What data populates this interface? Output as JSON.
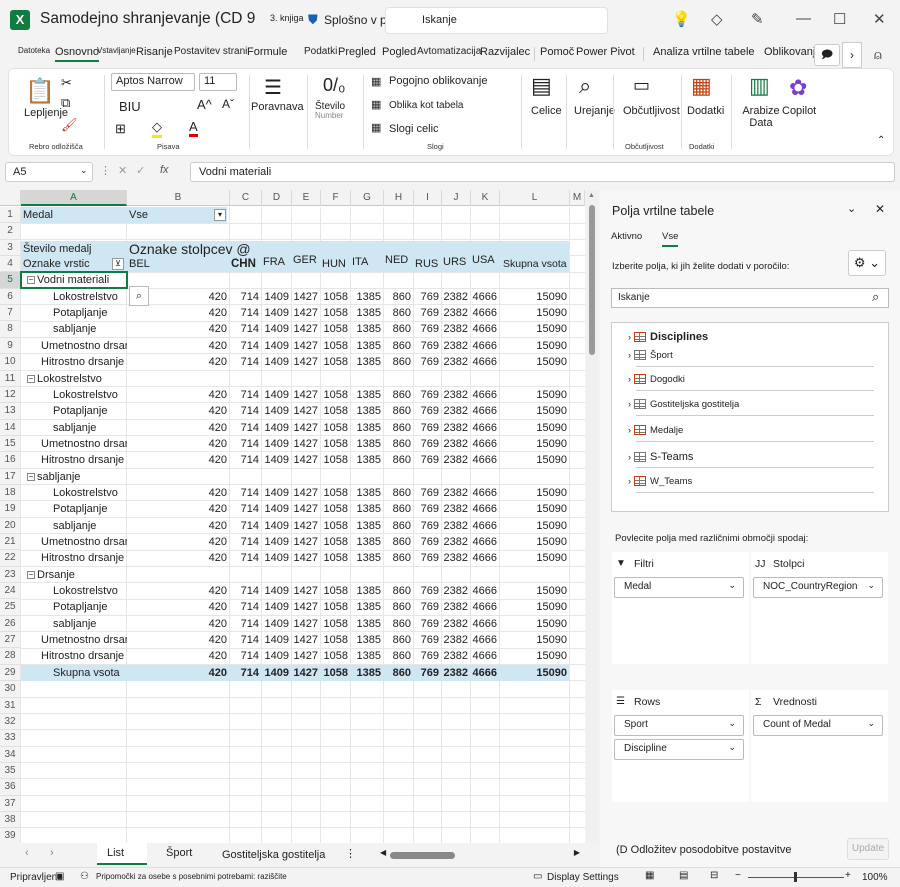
{
  "titlebar": {
    "title": "Samodejno shranjevanje (CD 9",
    "book": "3. knjiga",
    "sensitivity": "Splošno v p",
    "search": "Iskanje"
  },
  "tabs": [
    "Datoteka",
    "Osnovno",
    "Vstavljanje",
    "Risanje",
    "Postavitev strani",
    "Formule",
    "Podatki",
    "Pregled",
    "Pogled",
    "Avtomatizacija",
    "Razvijalec",
    "Pomoč",
    "Power Pivot",
    "Analiza vrtilne tabele",
    "Oblikovanje"
  ],
  "ribbon": {
    "paste": "Lepljenje",
    "clipboard_group": "Rebro odložišča",
    "font_name": "Aptos Narrow",
    "font_size": "11",
    "bold_italic_underline": "BIU",
    "font_group": "Pisava",
    "alignment": "Poravnava",
    "number": "Število",
    "number_sub": "Number",
    "conditional": "Pogojno oblikovanje",
    "format_table": "Oblika kot tabela",
    "cell_styles": "Slogi celic",
    "styles_group": "Slogi",
    "cells": "Celice",
    "editing": "Urejanje",
    "sensitivity": "Občutljivost",
    "sensitivity_group": "Občutljivost",
    "addins": "Dodatki",
    "addins_group": "Dodatki",
    "analyze": "Arabize Data",
    "copilot": "Copilot"
  },
  "formula": {
    "namebox": "A5",
    "fx": "fx",
    "content": "Vodni materiali"
  },
  "columns": [
    "A",
    "B",
    "C",
    "D",
    "E",
    "F",
    "G",
    "H",
    "I",
    "J",
    "K",
    "L",
    "M"
  ],
  "cells": {
    "a1": "Medal",
    "b1": "Vse",
    "a3": "Število medalj",
    "b3": "Oznake stolpcev @",
    "a4": "Oznake vrstic",
    "b4": "BEL",
    "countries": [
      "CHN",
      "FRA",
      "GER",
      "HUN",
      "ITA",
      "NED",
      "RUS",
      "URS",
      "USA"
    ],
    "total_header": "Skupna vsota"
  },
  "rows": [
    {
      "r": "1"
    },
    {
      "r": "2"
    },
    {
      "r": "3"
    },
    {
      "r": "4"
    },
    {
      "r": "5",
      "label": "Vodni materiali",
      "level": 0
    },
    {
      "r": "6",
      "label": "Lokostrelstvo",
      "level": 2,
      "vals": [
        "420",
        "714",
        "1409",
        "1427",
        "1058",
        "1385",
        "860",
        "769",
        "2382",
        "4666",
        "15090"
      ]
    },
    {
      "r": "7",
      "label": "Potapljanje",
      "level": 2,
      "vals": [
        "420",
        "714",
        "1409",
        "1427",
        "1058",
        "1385",
        "860",
        "769",
        "2382",
        "4666",
        "15090"
      ]
    },
    {
      "r": "8",
      "label": "sabljanje",
      "level": 2,
      "vals": [
        "420",
        "714",
        "1409",
        "1427",
        "1058",
        "1385",
        "860",
        "769",
        "2382",
        "4666",
        "15090"
      ]
    },
    {
      "r": "9",
      "label": "Umetnostno drsanje",
      "level": 1,
      "vals": [
        "420",
        "714",
        "1409",
        "1427",
        "1058",
        "1385",
        "860",
        "769",
        "2382",
        "4666",
        "15090"
      ]
    },
    {
      "r": "10",
      "label": "Hitrostno drsanje",
      "level": 1,
      "vals": [
        "420",
        "714",
        "1409",
        "1427",
        "1058",
        "1385",
        "860",
        "769",
        "2382",
        "4666",
        "15090"
      ]
    },
    {
      "r": "11",
      "label": "Lokostrelstvo",
      "level": 0
    },
    {
      "r": "12",
      "label": "Lokostrelstvo",
      "level": 2,
      "vals": [
        "420",
        "714",
        "1409",
        "1427",
        "1058",
        "1385",
        "860",
        "769",
        "2382",
        "4666",
        "15090"
      ]
    },
    {
      "r": "13",
      "label": "Potapljanje",
      "level": 2,
      "vals": [
        "420",
        "714",
        "1409",
        "1427",
        "1058",
        "1385",
        "860",
        "769",
        "2382",
        "4666",
        "15090"
      ]
    },
    {
      "r": "14",
      "label": "sabljanje",
      "level": 2,
      "vals": [
        "420",
        "714",
        "1409",
        "1427",
        "1058",
        "1385",
        "860",
        "769",
        "2382",
        "4666",
        "15090"
      ]
    },
    {
      "r": "15",
      "label": "Umetnostno drsanje",
      "level": 1,
      "vals": [
        "420",
        "714",
        "1409",
        "1427",
        "1058",
        "1385",
        "860",
        "769",
        "2382",
        "4666",
        "15090"
      ]
    },
    {
      "r": "16",
      "label": "Hitrostno drsanje",
      "level": 1,
      "vals": [
        "420",
        "714",
        "1409",
        "1427",
        "1058",
        "1385",
        "860",
        "769",
        "2382",
        "4666",
        "15090"
      ]
    },
    {
      "r": "17",
      "label": "sabljanje",
      "level": 0
    },
    {
      "r": "18",
      "label": "Lokostrelstvo",
      "level": 2,
      "vals": [
        "420",
        "714",
        "1409",
        "1427",
        "1058",
        "1385",
        "860",
        "769",
        "2382",
        "4666",
        "15090"
      ]
    },
    {
      "r": "19",
      "label": "Potapljanje",
      "level": 2,
      "vals": [
        "420",
        "714",
        "1409",
        "1427",
        "1058",
        "1385",
        "860",
        "769",
        "2382",
        "4666",
        "15090"
      ]
    },
    {
      "r": "20",
      "label": "sabljanje",
      "level": 2,
      "vals": [
        "420",
        "714",
        "1409",
        "1427",
        "1058",
        "1385",
        "860",
        "769",
        "2382",
        "4666",
        "15090"
      ]
    },
    {
      "r": "21",
      "label": "Umetnostno drsanje",
      "level": 1,
      "vals": [
        "420",
        "714",
        "1409",
        "1427",
        "1058",
        "1385",
        "860",
        "769",
        "2382",
        "4666",
        "15090"
      ]
    },
    {
      "r": "22",
      "label": "Hitrostno drsanje",
      "level": 1,
      "vals": [
        "420",
        "714",
        "1409",
        "1427",
        "1058",
        "1385",
        "860",
        "769",
        "2382",
        "4666",
        "15090"
      ]
    },
    {
      "r": "23",
      "label": "Drsanje",
      "level": 0
    },
    {
      "r": "24",
      "label": "Lokostrelstvo",
      "level": 2,
      "vals": [
        "420",
        "714",
        "1409",
        "1427",
        "1058",
        "1385",
        "860",
        "769",
        "2382",
        "4666",
        "15090"
      ]
    },
    {
      "r": "25",
      "label": "Potapljanje",
      "level": 2,
      "vals": [
        "420",
        "714",
        "1409",
        "1427",
        "1058",
        "1385",
        "860",
        "769",
        "2382",
        "4666",
        "15090"
      ]
    },
    {
      "r": "26",
      "label": "sabljanje",
      "level": 2,
      "vals": [
        "420",
        "714",
        "1409",
        "1427",
        "1058",
        "1385",
        "860",
        "769",
        "2382",
        "4666",
        "15090"
      ]
    },
    {
      "r": "27",
      "label": "Umetnostno drsanje",
      "level": 1,
      "vals": [
        "420",
        "714",
        "1409",
        "1427",
        "1058",
        "1385",
        "860",
        "769",
        "2382",
        "4666",
        "15090"
      ]
    },
    {
      "r": "28",
      "label": "Hitrostno drsanje",
      "level": 1,
      "vals": [
        "420",
        "714",
        "1409",
        "1427",
        "1058",
        "1385",
        "860",
        "769",
        "2382",
        "4666",
        "15090"
      ]
    },
    {
      "r": "29",
      "label": "Skupna vsota",
      "level": -1,
      "vals": [
        "420",
        "714",
        "1409",
        "1427",
        "1058",
        "1385",
        "860",
        "769",
        "2382",
        "4666",
        "15090"
      ]
    },
    {
      "r": "30"
    },
    {
      "r": "31"
    },
    {
      "r": "32"
    },
    {
      "r": "33"
    },
    {
      "r": "34"
    },
    {
      "r": "35"
    },
    {
      "r": "36"
    },
    {
      "r": "37"
    },
    {
      "r": "38"
    },
    {
      "r": "39"
    }
  ],
  "sheet_tabs": {
    "list": "List",
    "sport": "Šport",
    "gost": "Gostiteljska gostitelja"
  },
  "status": {
    "ready": "Pripravljeno",
    "accessibility": "Pripomočki za osebe s posebnimi potrebami: raziščite",
    "display": "Display Settings",
    "zoom": "100%"
  },
  "pane": {
    "title": "Polja vrtilne tabele",
    "tab_active": "Aktivno",
    "tab_all": "Vse",
    "prompt": "Izberite polja, ki jih želite dodati v poročilo:",
    "search": "Iskanje",
    "fields": [
      "Disciplines",
      "Šport",
      "Dogodki",
      "Gostiteljska gostitelja",
      "Medalje",
      "S-Teams",
      "W_Teams"
    ],
    "drag": "Povlecite polja med različnimi območji spodaj:",
    "filters_title": "Filtri",
    "columns_title": "Stolpci",
    "rows_title": "Rows",
    "values_title": "Vrednosti",
    "filters": [
      "Medal"
    ],
    "columns_items": [
      "NOC_CountryRegion"
    ],
    "rows_items": [
      "Sport",
      "Discipline"
    ],
    "values_items": [
      "Count of Medal"
    ],
    "defer": "(D Odložitev posodobitve postavitve",
    "update": "Update"
  }
}
